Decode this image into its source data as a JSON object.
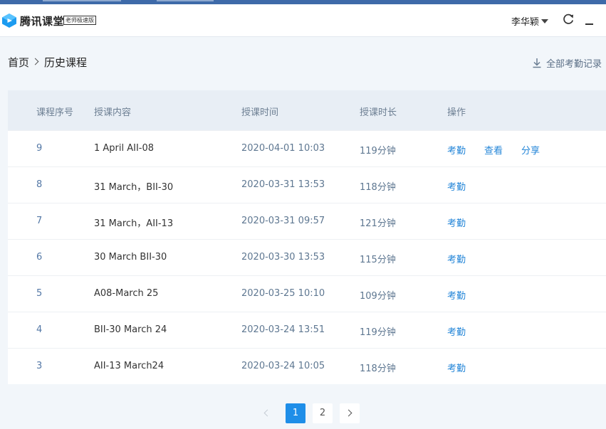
{
  "app": {
    "brand": "腾讯课堂",
    "badge": "老师极速版",
    "user_name": "李华颖"
  },
  "colors": {
    "accent": "#1f8ee8",
    "link": "#2486d8",
    "header_row": "#e8eef5",
    "page_bg": "#f2f6fa"
  },
  "icons": {
    "logo": "tencent-classroom-logo",
    "user_menu": "caret-down-icon",
    "refresh": "refresh-icon",
    "minimize": "minimize-icon",
    "export": "download-icon",
    "breadcrumb_sep": "chevron-right-icon"
  },
  "breadcrumb": {
    "home": "首页",
    "current": "历史课程"
  },
  "export_label": "全部考勤记录",
  "table": {
    "headers": {
      "number": "课程序号",
      "content": "授课内容",
      "time": "授课时间",
      "duration": "授课时长",
      "actions": "操作"
    },
    "rows": [
      {
        "number": "9",
        "content": "1 April AII-08",
        "time": "2020-04-01 10:03",
        "duration": "119分钟",
        "actions": [
          "考勤",
          "查看",
          "分享"
        ]
      },
      {
        "number": "8",
        "content": "31 March，BII-30",
        "time": "2020-03-31 13:53",
        "duration": "118分钟",
        "actions": [
          "考勤"
        ]
      },
      {
        "number": "7",
        "content": "31 March，AII-13",
        "time": "2020-03-31 09:57",
        "duration": "121分钟",
        "actions": [
          "考勤"
        ]
      },
      {
        "number": "6",
        "content": "30 March BII-30",
        "time": "2020-03-30 13:53",
        "duration": "115分钟",
        "actions": [
          "考勤"
        ]
      },
      {
        "number": "5",
        "content": "A08-March 25",
        "time": "2020-03-25 10:10",
        "duration": "109分钟",
        "actions": [
          "考勤"
        ]
      },
      {
        "number": "4",
        "content": "BII-30 March 24",
        "time": "2020-03-24 13:51",
        "duration": "119分钟",
        "actions": [
          "考勤"
        ]
      },
      {
        "number": "3",
        "content": "AII-13 March24",
        "time": "2020-03-24 10:05",
        "duration": "118分钟",
        "actions": [
          "考勤"
        ]
      }
    ]
  },
  "pagination": {
    "pages": [
      "1",
      "2"
    ],
    "current": "1"
  }
}
